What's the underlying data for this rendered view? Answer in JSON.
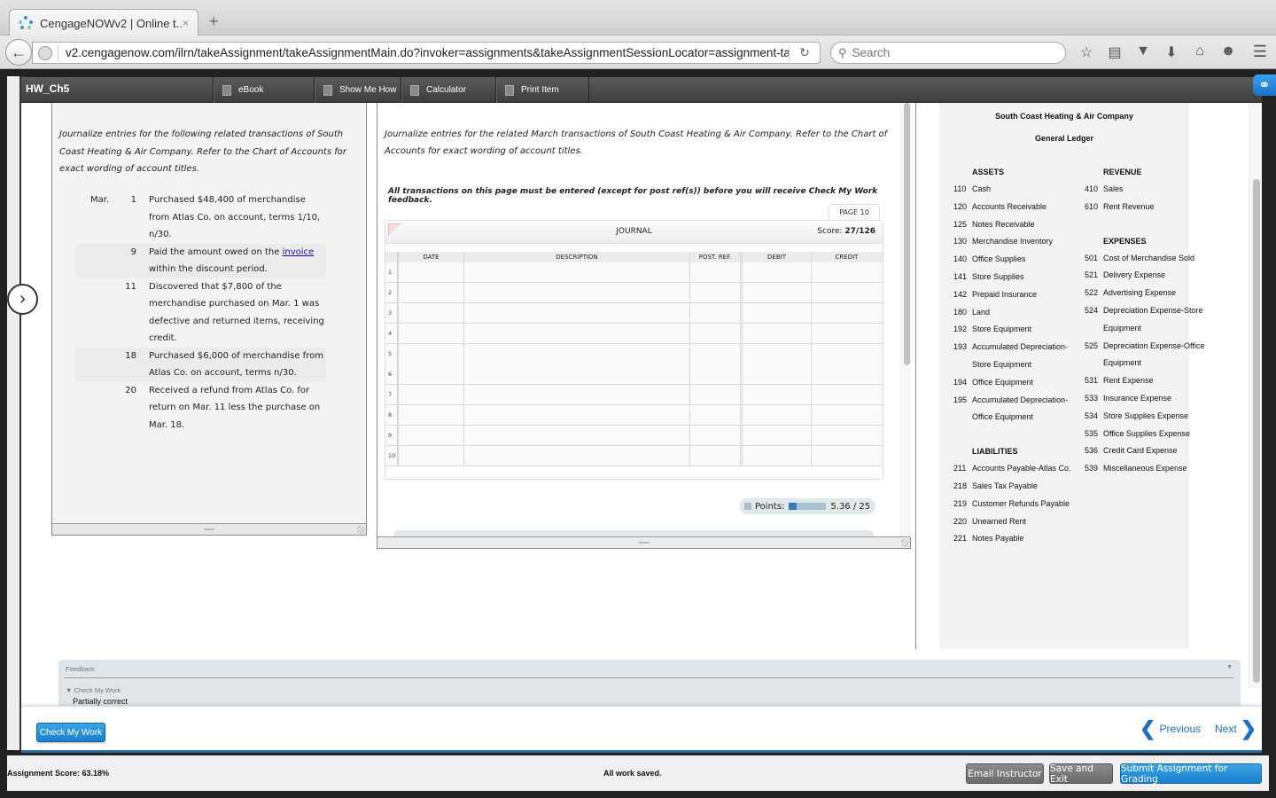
{
  "browser": {
    "tab_title": "CengageNOWv2 | Online t...",
    "new_tab": "+",
    "tab_close": "×",
    "url": "v2.cengagenow.com/ilrn/takeAssignment/takeAssignmentMain.do?invoker=assignments&takeAssignmentSessionLocator=assignment-ta",
    "search_placeholder": "Search",
    "icons": [
      "star-icon",
      "reading-list-icon",
      "pocket-icon",
      "download-icon",
      "home-icon",
      "chat-icon",
      "menu-icon"
    ]
  },
  "toolbar": {
    "title": "HW_Ch5",
    "buttons": [
      "eBook",
      "Show Me How",
      "Calculator",
      "Print Item"
    ]
  },
  "left_panel": {
    "intro": "Journalize entries for the following related transactions of South Coast Heating & Air Company. Refer to the Chart of Accounts for exact wording of account titles.",
    "month": "Mar.",
    "transactions": [
      {
        "day": "1",
        "text": "Purchased $48,400 of merchandise from Atlas Co. on account, terms 1/10, n/30."
      },
      {
        "day": "9",
        "text_before": "Paid the amount owed on the ",
        "link": "invoice",
        "text_after": " within the discount period."
      },
      {
        "day": "11",
        "text": "Discovered that $7,800 of the merchandise purchased on Mar. 1 was defective and returned items, receiving credit."
      },
      {
        "day": "18",
        "text": "Purchased $6,000 of merchandise from Atlas Co. on account, terms n/30."
      },
      {
        "day": "20",
        "text": "Received a refund from Atlas Co. for return on Mar. 11 less the purchase on Mar. 18."
      }
    ]
  },
  "middle_panel": {
    "intro": "Journalize entries for the related March transactions of South Coast Heating & Air Company. Refer to the Chart of Accounts for exact wording of account titles.",
    "note": "All transactions on this page must be entered (except for post ref(s)) before you will receive Check My Work feedback.",
    "page_tab": "PAGE 10",
    "journal": {
      "title": "JOURNAL",
      "score_label": "Score: ",
      "score_value": "27/126",
      "columns": [
        "DATE",
        "DESCRIPTION",
        "POST. REF.",
        "DEBIT",
        "CREDIT"
      ],
      "row_numbers": [
        "1",
        "2",
        "3",
        "4",
        "5",
        "6",
        "7",
        "8",
        "9",
        "10"
      ]
    },
    "points": {
      "label": "Points:",
      "earned": 5.36,
      "possible": 25,
      "text": "5.36 / 25"
    }
  },
  "chart_of_accounts": {
    "company": "South Coast Heating & Air Company",
    "subtitle": "General Ledger",
    "left_sections": [
      {
        "title": "ASSETS",
        "items": [
          {
            "num": "110",
            "name": "Cash"
          },
          {
            "num": "120",
            "name": "Accounts Receivable"
          },
          {
            "num": "125",
            "name": "Notes Receivable"
          },
          {
            "num": "130",
            "name": "Merchandise Inventory"
          },
          {
            "num": "140",
            "name": "Office Supplies"
          },
          {
            "num": "141",
            "name": "Store Supplies"
          },
          {
            "num": "142",
            "name": "Prepaid Insurance"
          },
          {
            "num": "180",
            "name": "Land"
          },
          {
            "num": "192",
            "name": "Store Equipment"
          },
          {
            "num": "193",
            "name": "Accumulated Depreciation-Store Equipment"
          },
          {
            "num": "194",
            "name": "Office Equipment"
          },
          {
            "num": "195",
            "name": "Accumulated Depreciation-Office Equipment"
          }
        ]
      },
      {
        "title": "LIABILITIES",
        "items": [
          {
            "num": "211",
            "name": "Accounts Payable-Atlas Co."
          },
          {
            "num": "218",
            "name": "Sales Tax Payable"
          },
          {
            "num": "219",
            "name": "Customer Refunds Payable"
          },
          {
            "num": "220",
            "name": "Unearned Rent"
          },
          {
            "num": "221",
            "name": "Notes Payable"
          }
        ]
      }
    ],
    "right_sections": [
      {
        "title": "REVENUE",
        "items": [
          {
            "num": "410",
            "name": "Sales"
          },
          {
            "num": "610",
            "name": "Rent Revenue"
          }
        ]
      },
      {
        "title": "EXPENSES",
        "items": [
          {
            "num": "501",
            "name": "Cost of Merchandise Sold"
          },
          {
            "num": "521",
            "name": "Delivery Expense"
          },
          {
            "num": "522",
            "name": "Advertising Expense"
          },
          {
            "num": "524",
            "name": "Depreciation Expense-Store Equipment"
          },
          {
            "num": "525",
            "name": "Depreciation Expense-Office Equipment"
          },
          {
            "num": "531",
            "name": "Rent Expense"
          },
          {
            "num": "533",
            "name": "Insurance Expense"
          },
          {
            "num": "534",
            "name": "Store Supplies Expense"
          },
          {
            "num": "535",
            "name": "Office Supplies Expense"
          },
          {
            "num": "536",
            "name": "Credit Card Expense"
          },
          {
            "num": "539",
            "name": "Miscellaneous Expense"
          }
        ]
      }
    ]
  },
  "feedback": {
    "title": "Feedback",
    "section": "▼ Check My Work",
    "status": "Partially correct"
  },
  "bottom": {
    "check_my_work": "Check My Work",
    "previous": "Previous",
    "next": "Next"
  },
  "status_bar": {
    "assignment_score": "Assignment Score: 63.18%",
    "saved": "All work saved.",
    "email_instructor": "Email Instructor",
    "save_exit": "Save and Exit",
    "submit": "Submit Assignment for Grading"
  }
}
